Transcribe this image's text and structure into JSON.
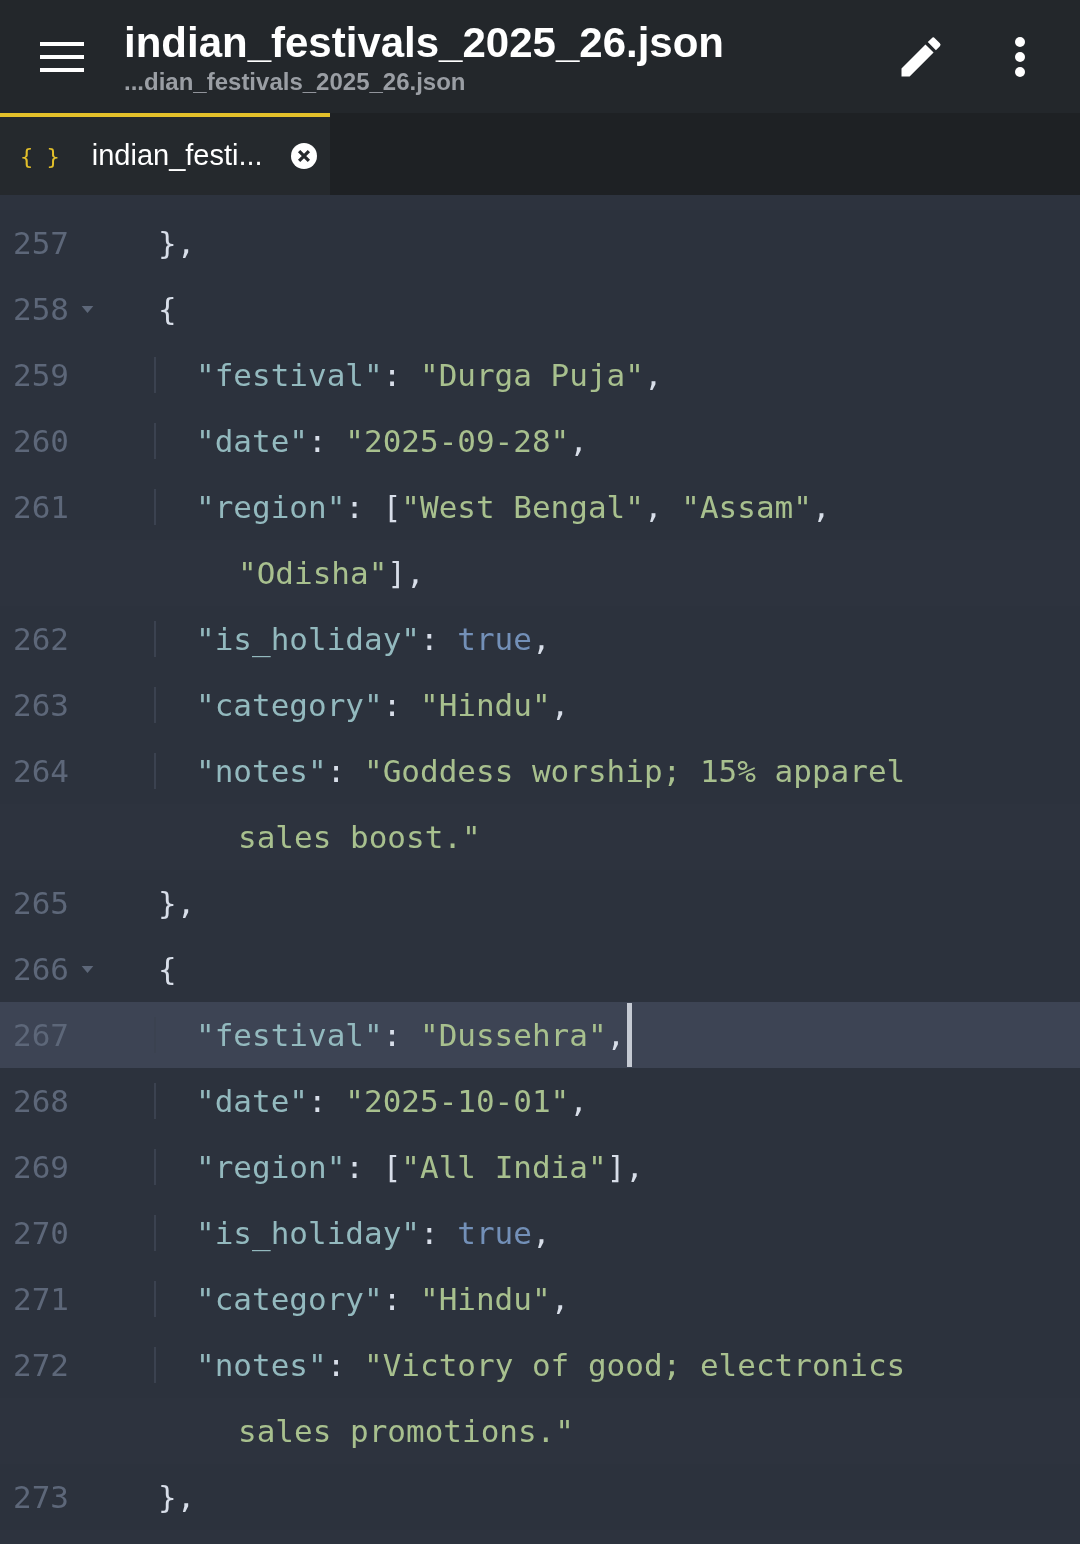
{
  "app_bar": {
    "title": "indian_festivals_2025_26.json",
    "subtitle": "...dian_festivals_2025_26.json"
  },
  "tabs": [
    {
      "icon_text": "{ }",
      "label": "indian_festi...",
      "selected": true
    }
  ],
  "lines": [
    {
      "number": "257",
      "selected": false,
      "segments": [
        {
          "kind": "punct",
          "text": "},"
        }
      ]
    },
    {
      "number": "258",
      "selected": false,
      "expanded": true,
      "segments": [
        {
          "kind": "punct",
          "text": "{"
        }
      ],
      "children": [
        {
          "number": "259",
          "selected": false,
          "segments": [
            {
              "kind": "key",
              "text": "\"festival\""
            },
            {
              "kind": "punct",
              "text": ": "
            },
            {
              "kind": "string",
              "text": "\"Durga Puja\""
            },
            {
              "kind": "punct",
              "text": ","
            }
          ]
        },
        {
          "number": "260",
          "selected": false,
          "segments": [
            {
              "kind": "key",
              "text": "\"date\""
            },
            {
              "kind": "punct",
              "text": ": "
            },
            {
              "kind": "string",
              "text": "\"2025-09-28\""
            },
            {
              "kind": "punct",
              "text": ","
            }
          ]
        },
        {
          "number": "261",
          "selected": false,
          "segments": [
            {
              "kind": "key",
              "text": "\"region\""
            },
            {
              "kind": "punct",
              "text": ": ["
            },
            {
              "kind": "string",
              "text": "\"West Bengal\""
            },
            {
              "kind": "punct",
              "text": ", "
            },
            {
              "kind": "string",
              "text": "\"Assam\""
            },
            {
              "kind": "punct",
              "text": ","
            }
          ],
          "continuation": [
            {
              "kind": "string",
              "text": "\"Odisha\""
            },
            {
              "kind": "punct",
              "text": "],"
            }
          ]
        },
        {
          "number": "262",
          "selected": false,
          "segments": [
            {
              "kind": "key",
              "text": "\"is_holiday\""
            },
            {
              "kind": "punct",
              "text": ": "
            },
            {
              "kind": "bool",
              "text": "true"
            },
            {
              "kind": "punct",
              "text": ","
            }
          ]
        },
        {
          "number": "263",
          "selected": false,
          "segments": [
            {
              "kind": "key",
              "text": "\"category\""
            },
            {
              "kind": "punct",
              "text": ": "
            },
            {
              "kind": "string",
              "text": "\"Hindu\""
            },
            {
              "kind": "punct",
              "text": ","
            }
          ]
        },
        {
          "number": "264",
          "selected": false,
          "segments": [
            {
              "kind": "key",
              "text": "\"notes\""
            },
            {
              "kind": "punct",
              "text": ": "
            },
            {
              "kind": "string",
              "text": "\"Goddess worship; 15% apparel"
            }
          ],
          "continuation": [
            {
              "kind": "string",
              "text": "sales boost.\""
            }
          ]
        }
      ]
    },
    {
      "number": "265",
      "selected": false,
      "segments": [
        {
          "kind": "punct",
          "text": "},"
        }
      ]
    },
    {
      "number": "266",
      "selected": false,
      "expanded": true,
      "segments": [
        {
          "kind": "punct",
          "text": "{"
        }
      ],
      "children": [
        {
          "number": "267",
          "selected": true,
          "segments": [
            {
              "kind": "key",
              "text": "\"festival\""
            },
            {
              "kind": "punct",
              "text": ": "
            },
            {
              "kind": "string",
              "text": "\"Dussehra\""
            },
            {
              "kind": "punct",
              "text": ","
            }
          ]
        },
        {
          "number": "268",
          "selected": false,
          "segments": [
            {
              "kind": "key",
              "text": "\"date\""
            },
            {
              "kind": "punct",
              "text": ": "
            },
            {
              "kind": "string",
              "text": "\"2025-10-01\""
            },
            {
              "kind": "punct",
              "text": ","
            }
          ]
        },
        {
          "number": "269",
          "selected": false,
          "segments": [
            {
              "kind": "key",
              "text": "\"region\""
            },
            {
              "kind": "punct",
              "text": ": ["
            },
            {
              "kind": "string",
              "text": "\"All India\""
            },
            {
              "kind": "punct",
              "text": "],"
            }
          ]
        },
        {
          "number": "270",
          "selected": false,
          "segments": [
            {
              "kind": "key",
              "text": "\"is_holiday\""
            },
            {
              "kind": "punct",
              "text": ": "
            },
            {
              "kind": "bool",
              "text": "true"
            },
            {
              "kind": "punct",
              "text": ","
            }
          ]
        },
        {
          "number": "271",
          "selected": false,
          "segments": [
            {
              "kind": "key",
              "text": "\"category\""
            },
            {
              "kind": "punct",
              "text": ": "
            },
            {
              "kind": "string",
              "text": "\"Hindu\""
            },
            {
              "kind": "punct",
              "text": ","
            }
          ]
        },
        {
          "number": "272",
          "selected": false,
          "segments": [
            {
              "kind": "key",
              "text": "\"notes\""
            },
            {
              "kind": "punct",
              "text": ": "
            },
            {
              "kind": "string",
              "text": "\"Victory of good; electronics"
            }
          ],
          "continuation": [
            {
              "kind": "string",
              "text": "sales promotions.\""
            }
          ]
        }
      ]
    },
    {
      "number": "273",
      "selected": false,
      "segments": [
        {
          "kind": "punct",
          "text": "},"
        }
      ]
    }
  ]
}
